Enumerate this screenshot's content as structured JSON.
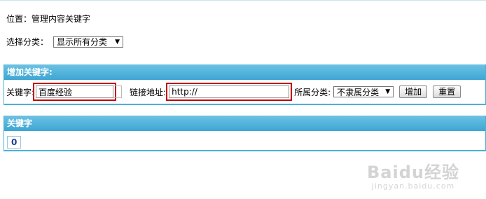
{
  "location": "位置：管理内容关键字",
  "filter": {
    "label": "选择分类：",
    "selected": "显示所有分类"
  },
  "add_panel": {
    "title": "增加关键字:",
    "keyword_label": "关键字:",
    "keyword_value": "百度经验",
    "link_label": "链接地址:",
    "link_value": "http://",
    "category_label": "所属分类:",
    "category_selected": "不隶属分类",
    "add_button": "增加",
    "reset_button": "重置"
  },
  "list_panel": {
    "title": "关键字",
    "count": "0"
  },
  "watermark": {
    "logo": "Baidu经验",
    "url": "jingyan.baidu.com"
  },
  "colors": {
    "panel_header": "#4bb0d6",
    "highlight": "#c00000"
  }
}
